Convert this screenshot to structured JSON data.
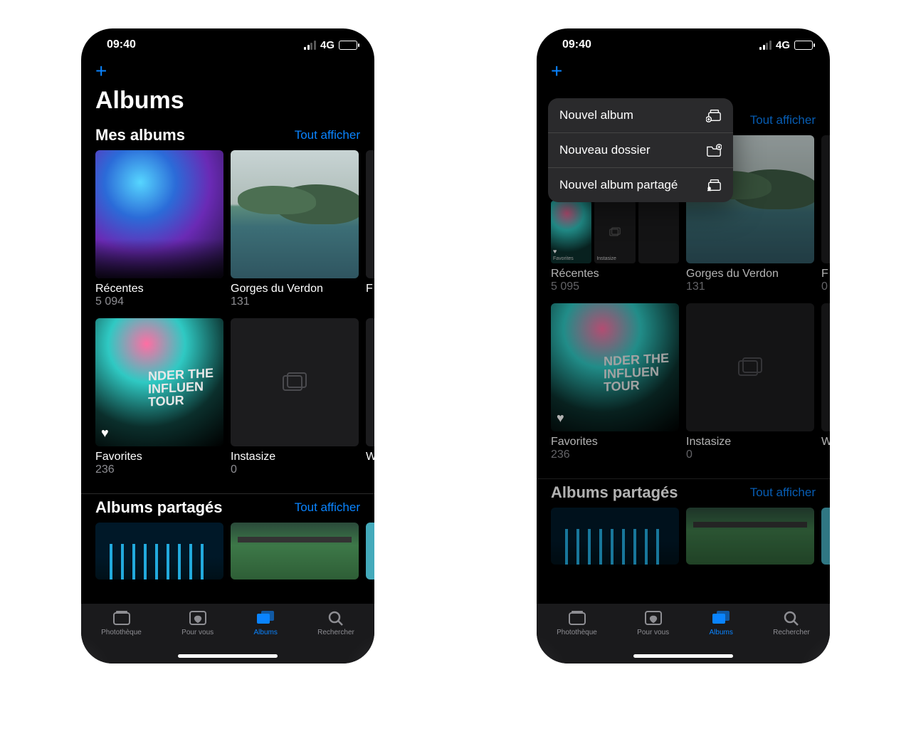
{
  "status": {
    "time": "09:40",
    "network": "4G"
  },
  "header": {
    "add_symbol": "+",
    "page_title": "Albums"
  },
  "sections": {
    "my_albums": {
      "title": "Mes albums",
      "see_all": "Tout afficher"
    },
    "shared": {
      "title": "Albums partagés",
      "see_all": "Tout afficher"
    }
  },
  "left_albums": [
    {
      "name": "Récentes",
      "count": "5 094"
    },
    {
      "name": "Gorges du Verdon",
      "count": "131"
    },
    {
      "name": "F",
      "count": ""
    },
    {
      "name": "Favorites",
      "count": "236"
    },
    {
      "name": "Instasize",
      "count": "0"
    },
    {
      "name": "W",
      "count": ""
    }
  ],
  "right_albums": [
    {
      "name": "Récentes",
      "count": "5 095"
    },
    {
      "name": "Gorges du Verdon",
      "count": "131"
    },
    {
      "name": "F",
      "count": "0"
    },
    {
      "name": "Favorites",
      "count": "236"
    },
    {
      "name": "Instasize",
      "count": "0"
    },
    {
      "name": "W",
      "count": ""
    }
  ],
  "mini_labels": {
    "recentes": "Récentes",
    "recentes_count": "5 094",
    "gorges": "Gorges du Verdon",
    "gorges_count": "131",
    "fav": "Favorites",
    "insta": "Instasize"
  },
  "popup": {
    "new_album": "Nouvel album",
    "new_folder": "Nouveau dossier",
    "new_shared": "Nouvel album partagé"
  },
  "tabs": {
    "library": "Photothèque",
    "foryou": "Pour vous",
    "albums": "Albums",
    "search": "Rechercher"
  }
}
